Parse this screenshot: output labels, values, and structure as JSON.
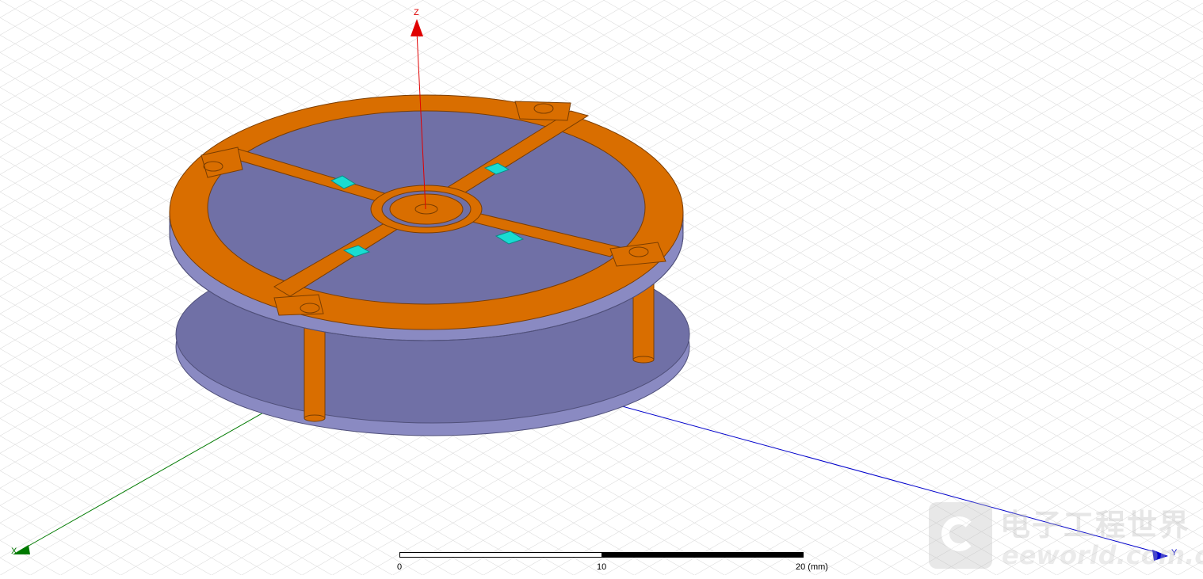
{
  "axes": {
    "z_label": "Z",
    "y_label": "Y",
    "x_label": "X",
    "colors": {
      "z": "#e00000",
      "y": "#0000cc",
      "x": "#007a00"
    }
  },
  "model": {
    "copper_color": "#d96e00",
    "substrate_color": "#7070a6",
    "substrate_edge_color": "#8a8ac2",
    "chip_color": "#19dcd2"
  },
  "scale_bar": {
    "ticks": [
      "0",
      "10",
      "20 (mm)"
    ]
  },
  "watermark": {
    "cn_text": "电子工程世界",
    "en_text": "eeworld.com.cn"
  }
}
